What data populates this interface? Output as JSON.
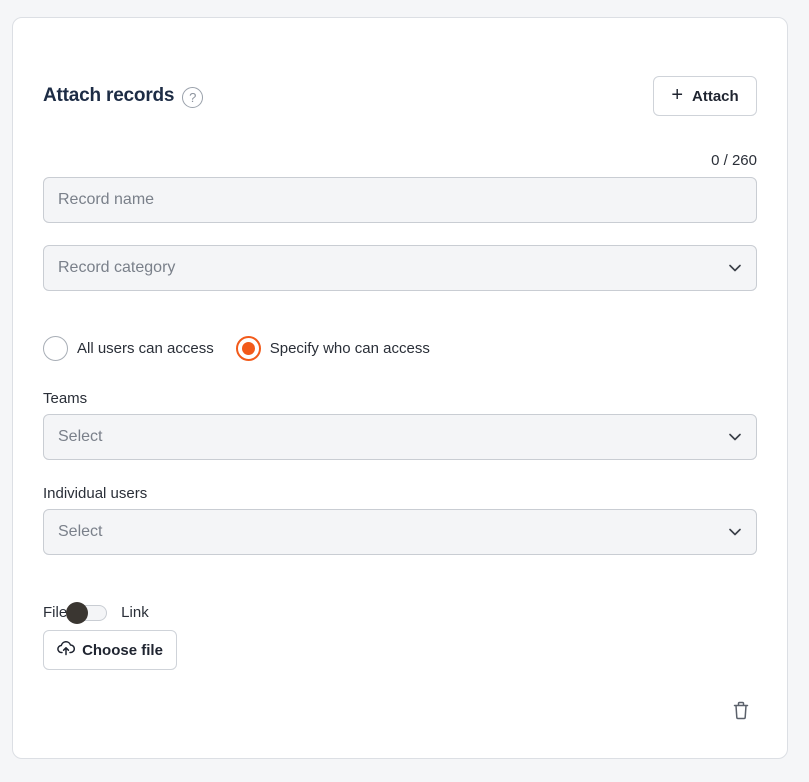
{
  "form": {
    "title": "Attach records",
    "help_icon": "question-circle-icon",
    "help_glyph": "?",
    "attach_button": {
      "icon": "plus-icon",
      "glyph": "+",
      "label": "Attach"
    },
    "counter": "0 / 260",
    "record_name": {
      "placeholder": "Record name",
      "value": ""
    },
    "record_category": {
      "placeholder": "Record category",
      "icon": "chevron-down-icon"
    },
    "access": {
      "options": [
        {
          "label": "All users can access",
          "selected": false
        },
        {
          "label": "Specify who can access",
          "selected": true
        }
      ],
      "accent_color": "#f25a1a"
    },
    "teams": {
      "label": "Teams",
      "placeholder": "Select",
      "icon": "chevron-down-icon"
    },
    "individual_users": {
      "label": "Individual users",
      "placeholder": "Select",
      "icon": "chevron-down-icon"
    },
    "source_toggle": {
      "left_label": "File",
      "right_label": "Link",
      "state": "File"
    },
    "choose_file_button": {
      "icon": "cloud-upload-icon",
      "label": "Choose file"
    },
    "delete_icon": "trash-icon"
  }
}
